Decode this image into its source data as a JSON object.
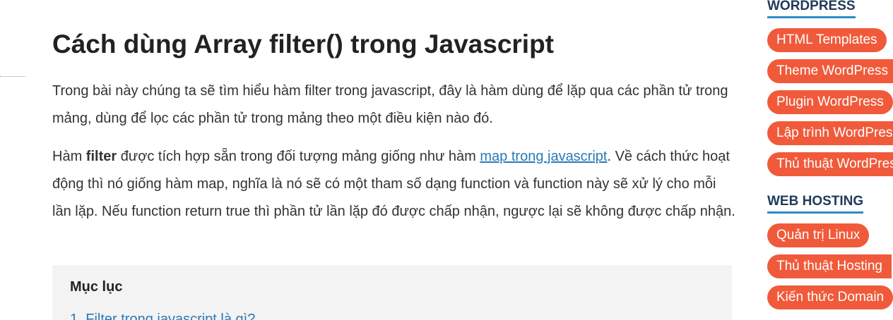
{
  "article": {
    "title": "Cách dùng Array filter() trong Javascript",
    "para1": "Trong bài này chúng ta sẽ tìm hiểu hàm filter trong javascript, đây là hàm dùng để lặp qua các phần tử trong mảng, dùng để lọc các phần tử trong mảng theo một điều kiện nào đó.",
    "para2_prefix": "Hàm ",
    "para2_bold": "filter",
    "para2_mid": " được tích hợp sẵn trong đối tượng mảng giống như hàm ",
    "para2_link": "map trong javascript",
    "para2_suffix": ". Về cách thức hoạt động thì nó giống hàm map, nghĩa là nó sẽ có một tham số dạng function và function này sẽ xử lý cho mỗi lần lặp. Nếu function return true thì phần tử lần lặp đó được chấp nhận, ngược lại sẽ không được chấp nhận."
  },
  "toc": {
    "title": "Mục lục",
    "items": [
      "1. Filter trong javascript là gì?"
    ]
  },
  "sidebar": {
    "wordpress": {
      "heading": "WORDPRESS",
      "tags": [
        "HTML Templates",
        "Theme WordPress",
        "Plugin WordPress",
        "Lập trình WordPress",
        "Thủ thuật WordPress"
      ]
    },
    "hosting": {
      "heading": "WEB HOSTING",
      "tags": [
        "Quản trị Linux",
        "Thủ thuật Hosting",
        "Kiến thức Domain"
      ]
    }
  },
  "colors": {
    "tag_background": "#f05a3a",
    "link": "#2a7ab8",
    "heading_underline": "#2a8bc8",
    "toc_background": "#f3f3f3"
  }
}
